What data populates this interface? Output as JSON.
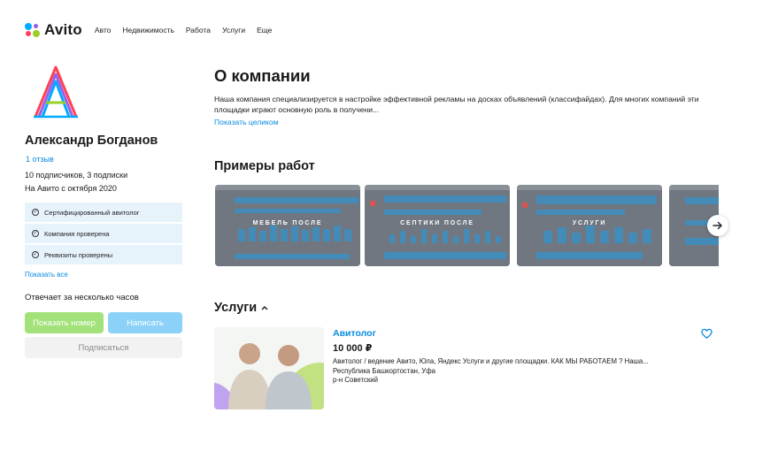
{
  "header": {
    "logo_text": "Avito",
    "nav": [
      "Авто",
      "Недвижимость",
      "Работа",
      "Услуги",
      "Еще"
    ]
  },
  "profile": {
    "name": "Александр Богданов",
    "reviews": "1 отзыв",
    "subscribers": "10 подписчиков, 3 подписки",
    "since": "На Авито с октября 2020",
    "badges": [
      "Сертифицированный авитолог",
      "Компания проверена",
      "Реквизиты проверены"
    ],
    "show_all": "Показать все",
    "reply_time": "Отвечает за несколько часов",
    "show_phone_label": "Показать номер",
    "write_label": "Написать",
    "subscribe_label": "Подписаться",
    "colors": {
      "phone_button": "#a3e27a",
      "write_button": "#8cd2f8",
      "link": "#0a8be0",
      "badge_bg": "#e7f3fb"
    }
  },
  "about": {
    "title": "О компании",
    "text": "Наша компания специализируется в настройке эффективной рекламы на досках объявлений (классифайдах). Для многих компаний эти площадки играют основную роль в получени...",
    "show_full": "Показать целиком"
  },
  "works": {
    "title": "Примеры работ",
    "items": [
      {
        "label": "МЕБЕЛЬ ПОСЛЕ"
      },
      {
        "label": "СЕПТИКИ ПОСЛЕ"
      },
      {
        "label": "УСЛУГИ"
      },
      {
        "label": ""
      }
    ],
    "next_icon": "arrow-right-icon"
  },
  "services": {
    "title": "Услуги",
    "toggle_icon": "chevron-up-icon",
    "items": [
      {
        "title": "Авитолог",
        "price": "10 000 ₽",
        "description": "Авитолог / ведение Авито, Юла, Яндекс Услуги и другие площадки. КАК МЫ РАБОТАЕМ ? Наша...",
        "region": "Республика Башкортостан, Уфа",
        "district": "р-н Советский",
        "favorite_icon": "heart-icon"
      }
    ]
  }
}
